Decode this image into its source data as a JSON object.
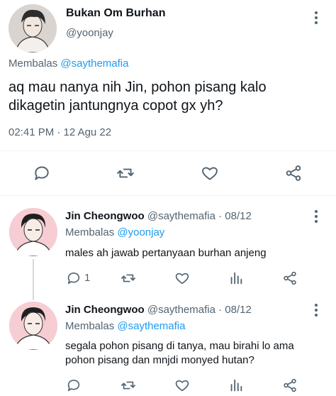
{
  "main_tweet": {
    "display_name": "Bukan Om Burhan",
    "handle": "@yoonjay",
    "reply_prefix": "Membalas",
    "reply_to": "@saythemafia",
    "text_line1": "aq mau nanya nih Jin, pohon pisang kalo",
    "text_line2": "dikagetin jantungnya copot gx yh?",
    "timestamp": "02:41 PM · 12 Agu 22",
    "actions": [
      "reply-icon",
      "retweet-icon",
      "like-icon",
      "share-icon"
    ]
  },
  "replies": [
    {
      "display_name": "Jin Cheongwoo",
      "meta": "@saythemafia · 08/12",
      "reply_prefix": "Membalas",
      "reply_to": "@yoonjay",
      "text_line1": "males ah jawab pertanyaan burhan anjeng",
      "text_line2": "",
      "reply_count": "1"
    },
    {
      "display_name": "Jin Cheongwoo",
      "meta": "@saythemafia · 08/12",
      "reply_prefix": "Membalas",
      "reply_to": "@saythemafia",
      "text_line1": "segala pohon pisang di tanya, mau birahi lo ama",
      "text_line2": "pohon pisang dan mnjdi monyed hutan?",
      "reply_count": ""
    }
  ],
  "colors": {
    "accent": "#1d9bf0",
    "text": "#0f1419",
    "muted": "#536471",
    "divider": "#eff3f4"
  }
}
